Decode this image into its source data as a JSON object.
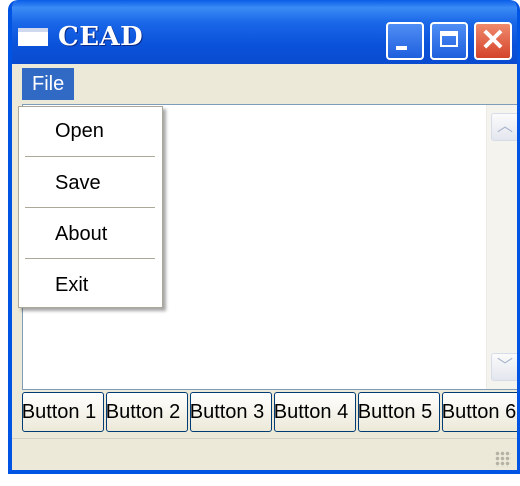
{
  "window": {
    "title": "CEAD",
    "colors": {
      "titlebar": "#0a52da",
      "close_button": "#d4432a",
      "menu_highlight": "#316ac5",
      "frame": "#ece9d8"
    }
  },
  "titlebar_buttons": {
    "minimize_icon": "minimize-icon",
    "maximize_icon": "maximize-icon",
    "close_icon": "close-icon",
    "close_glyph": "✕"
  },
  "menubar": {
    "file_label": "File"
  },
  "file_menu": {
    "items": [
      {
        "label": "Open"
      },
      {
        "label": "Save"
      },
      {
        "label": "About"
      },
      {
        "label": "Exit"
      }
    ]
  },
  "scrollbar": {
    "up_glyph": "︿",
    "down_glyph": "﹀"
  },
  "buttons": [
    {
      "label": "Button 1"
    },
    {
      "label": "Button 2"
    },
    {
      "label": "Button 3"
    },
    {
      "label": "Button 4"
    },
    {
      "label": "Button 5"
    },
    {
      "label": "Button 6"
    }
  ]
}
